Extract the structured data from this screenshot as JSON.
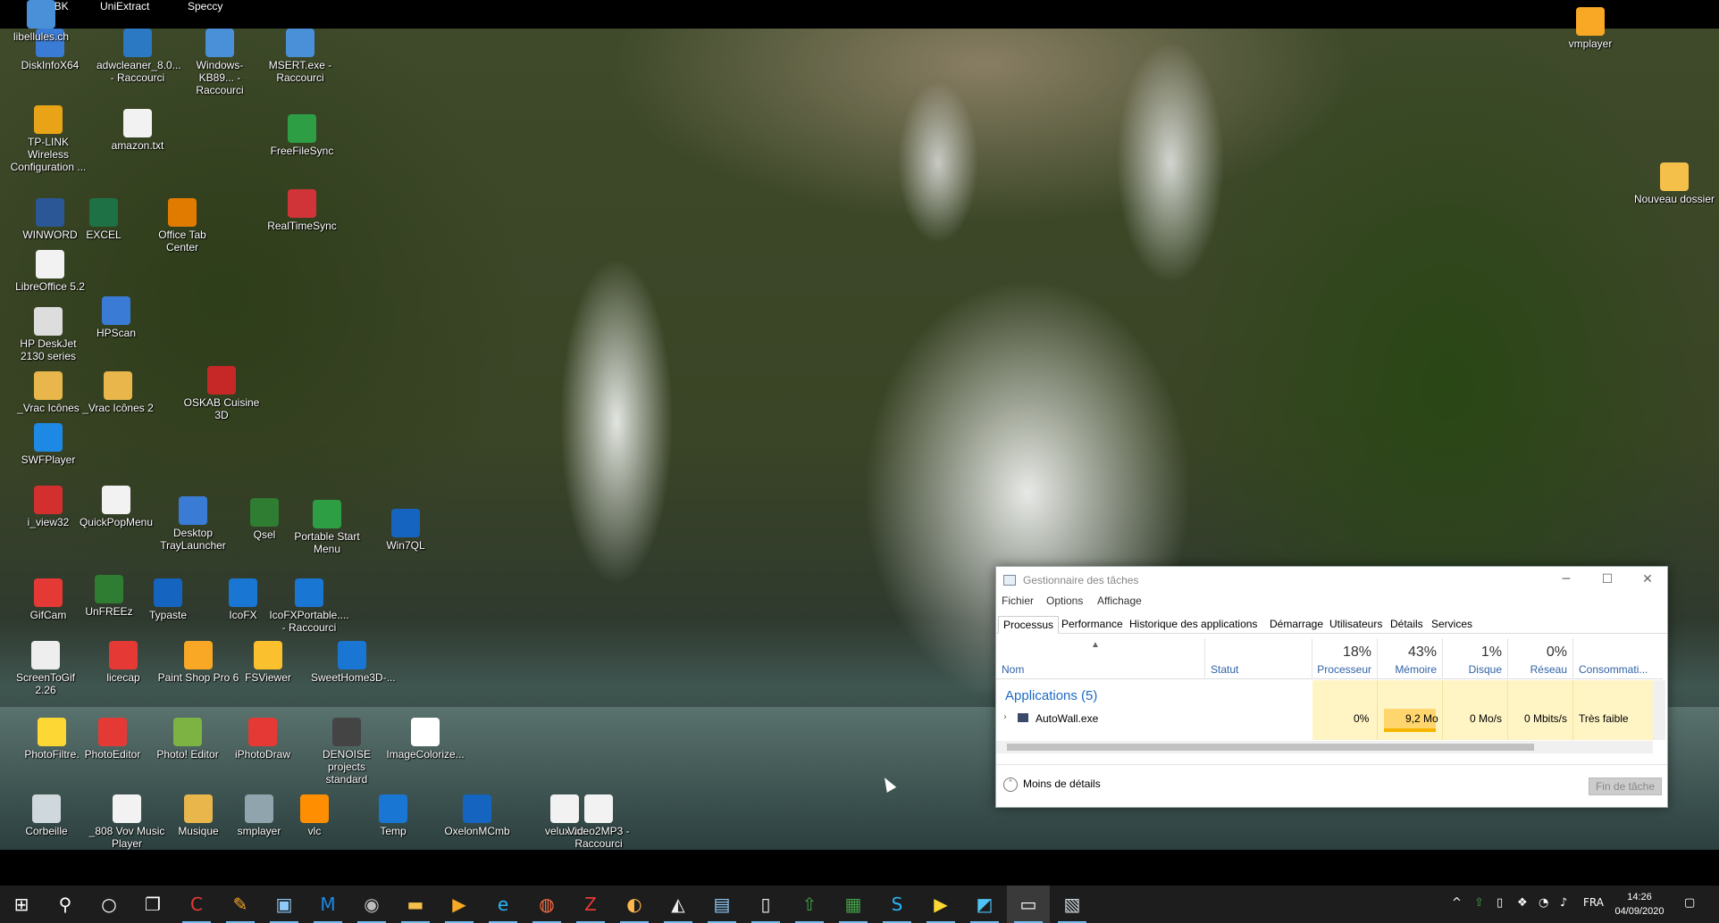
{
  "top_labels": [
    "DrvBK",
    "UniExtract",
    "Speccy"
  ],
  "desktop_icons": [
    {
      "label": "DiskInfoX64",
      "icon": "disk-icon",
      "color": "#3a7bd5"
    },
    {
      "label": "adwcleaner_8.0... - Raccourci",
      "icon": "gear-icon",
      "color": "#2b79c2"
    },
    {
      "label": "Windows-KB89... - Raccourci",
      "icon": "installer-icon",
      "color": "#4a90d9"
    },
    {
      "label": "MSERT.exe - Raccourci",
      "icon": "installer-icon",
      "color": "#4a90d9"
    },
    {
      "label": "TP-LINK Wireless Configuration ...",
      "icon": "wifi-icon",
      "color": "#e8a317"
    },
    {
      "label": "amazon.txt",
      "icon": "text-file-icon",
      "color": "#f2f2f2"
    },
    {
      "label": "FreeFileSync",
      "icon": "sync-icon",
      "color": "#2e9e45"
    },
    {
      "label": "WINWORD",
      "icon": "word-icon",
      "color": "#2b5797"
    },
    {
      "label": "EXCEL",
      "icon": "excel-icon",
      "color": "#1e7145"
    },
    {
      "label": "Office Tab Center",
      "icon": "office-tab-icon",
      "color": "#e07b00"
    },
    {
      "label": "RealTimeSync",
      "icon": "sync-icon",
      "color": "#d13438"
    },
    {
      "label": "LibreOffice 5.2",
      "icon": "document-icon",
      "color": "#f2f2f2"
    },
    {
      "label": "HP DeskJet 2130 series",
      "icon": "printer-icon",
      "color": "#dddddd"
    },
    {
      "label": "HPScan",
      "icon": "scanner-icon",
      "color": "#3a7bd5"
    },
    {
      "label": "_Vrac Icônes",
      "icon": "archive-icon",
      "color": "#e8b64a"
    },
    {
      "label": "_Vrac Icônes 2",
      "icon": "archive-icon",
      "color": "#e8b64a"
    },
    {
      "label": "OSKAB Cuisine 3D",
      "icon": "oskab-icon",
      "color": "#c62828"
    },
    {
      "label": "SWFPlayer",
      "icon": "swf-icon",
      "color": "#1e88e5"
    },
    {
      "label": "i_view32",
      "icon": "irfanview-icon",
      "color": "#d32f2f"
    },
    {
      "label": "QuickPopMenu",
      "icon": "menu-icon",
      "color": "#f2f2f2"
    },
    {
      "label": "Desktop TrayLauncher",
      "icon": "monitor-icon",
      "color": "#3a7bd5"
    },
    {
      "label": "Qsel",
      "icon": "qsel-icon",
      "color": "#2e7d32"
    },
    {
      "label": "Portable Start Menu",
      "icon": "arrow-up-icon",
      "color": "#2e9e45"
    },
    {
      "label": "Win7QL",
      "icon": "launch-icon",
      "color": "#1565c0"
    },
    {
      "label": "GifCam",
      "icon": "camera-icon",
      "color": "#e53935"
    },
    {
      "label": "UnFREEz",
      "icon": "globe-icon",
      "color": "#2e7d32"
    },
    {
      "label": "Typaste",
      "icon": "typaste-icon",
      "color": "#1565c0"
    },
    {
      "label": "IcoFX",
      "icon": "icofx-icon",
      "color": "#1976d2"
    },
    {
      "label": "IcoFXPortable.... - Raccourci",
      "icon": "icofx-icon",
      "color": "#1976d2"
    },
    {
      "label": "ScreenToGif 2.26",
      "icon": "screen-icon",
      "color": "#eeeeee"
    },
    {
      "label": "licecap",
      "icon": "record-icon",
      "color": "#e53935"
    },
    {
      "label": "Paint Shop Pro 6",
      "icon": "palette-icon",
      "color": "#f9a825"
    },
    {
      "label": "FSViewer",
      "icon": "eye-icon",
      "color": "#fbc02d"
    },
    {
      "label": "SweetHome3D-...",
      "icon": "house-icon",
      "color": "#1976d2"
    },
    {
      "label": "PhotoFiltre.",
      "icon": "photofiltre-icon",
      "color": "#fdd835"
    },
    {
      "label": "PhotoEditor",
      "icon": "photo-editor-icon",
      "color": "#e53935"
    },
    {
      "label": "Photo! Editor",
      "icon": "photo-icon",
      "color": "#7cb342"
    },
    {
      "label": "iPhotoDraw",
      "icon": "draw-icon",
      "color": "#e53935"
    },
    {
      "label": "DENOISE projects standard",
      "icon": "lens-icon",
      "color": "#444444"
    },
    {
      "label": "ImageColorize...",
      "icon": "portrait-icon",
      "color": "#ffffff"
    },
    {
      "label": "Corbeille",
      "icon": "recycle-bin-icon",
      "color": "#cfd8dc"
    },
    {
      "label": "_808 Vov Music Player",
      "icon": "music-icon",
      "color": "#f2f2f2"
    },
    {
      "label": "Musique",
      "icon": "folder-music-icon",
      "color": "#e8b64a"
    },
    {
      "label": "smplayer",
      "icon": "film-icon",
      "color": "#90a4ae"
    },
    {
      "label": "vlc",
      "icon": "vlc-cone-icon",
      "color": "#ff8f00"
    },
    {
      "label": "Temp",
      "icon": "folder-icon",
      "color": "#1976d2"
    },
    {
      "label": "OxelonMCmb",
      "icon": "media-converter-icon",
      "color": "#1565c0"
    },
    {
      "label": "velux.txt",
      "icon": "text-file-icon",
      "color": "#f2f2f2"
    },
    {
      "label": "Video2MP3 - Raccourci",
      "icon": "video-icon",
      "color": "#f2f2f2"
    },
    {
      "label": "vmplayer",
      "icon": "play-icon",
      "color": "#f9a825"
    },
    {
      "label": "Nouveau dossier",
      "icon": "folder-icon",
      "color": "#f5c04a"
    },
    {
      "label": "libellules.ch",
      "icon": "web-shortcut-icon",
      "color": "#4a90d9"
    }
  ],
  "taskmgr": {
    "title": "Gestionnaire des tâches",
    "menu": [
      "Fichier",
      "Options",
      "Affichage"
    ],
    "tabs": [
      "Processus",
      "Performance",
      "Historique des applications",
      "Démarrage",
      "Utilisateurs",
      "Détails",
      "Services"
    ],
    "columns": {
      "name": "Nom",
      "status": "Statut",
      "cpu": {
        "pct": "18%",
        "label": "Processeur"
      },
      "memory": {
        "pct": "43%",
        "label": "Mémoire"
      },
      "disk": {
        "pct": "1%",
        "label": "Disque"
      },
      "network": {
        "pct": "0%",
        "label": "Réseau"
      },
      "power": "Consommati..."
    },
    "group_label": "Applications (5)",
    "process": {
      "name": "AutoWall.exe",
      "cpu": "0%",
      "memory": "9,2 Mo",
      "disk": "0 Mo/s",
      "network": "0 Mbits/s",
      "power": "Très faible"
    },
    "less_details": "Moins de détails",
    "end_task": "Fin de tâche"
  },
  "taskbar": {
    "pinned": [
      {
        "name": "start-button",
        "glyph": "⊞",
        "color": "#ffffff"
      },
      {
        "name": "search-icon",
        "glyph": "⚲",
        "color": "#ffffff"
      },
      {
        "name": "cortana-icon",
        "glyph": "○",
        "color": "#ffffff"
      },
      {
        "name": "task-view-icon",
        "glyph": "❐",
        "color": "#ffffff"
      },
      {
        "name": "ccleaner-icon",
        "glyph": "C",
        "color": "#e53935"
      },
      {
        "name": "broom-icon",
        "glyph": "✎",
        "color": "#f9a825"
      },
      {
        "name": "control-panel-icon",
        "glyph": "▣",
        "color": "#90caf9"
      },
      {
        "name": "malwarebytes-icon",
        "glyph": "M",
        "color": "#1e88e5"
      },
      {
        "name": "disc-icon",
        "glyph": "◉",
        "color": "#bdbdbd"
      },
      {
        "name": "file-explorer-icon",
        "glyph": "▬",
        "color": "#f5c04a"
      },
      {
        "name": "media-icon",
        "glyph": "▶",
        "color": "#f9a825"
      },
      {
        "name": "edge-icon",
        "glyph": "e",
        "color": "#29b6f6"
      },
      {
        "name": "firefox-icon",
        "glyph": "◍",
        "color": "#ff7043"
      },
      {
        "name": "filezilla-icon",
        "glyph": "Z",
        "color": "#e53935"
      },
      {
        "name": "drive-icon",
        "glyph": "◐",
        "color": "#ffb74d"
      },
      {
        "name": "inkscape-icon",
        "glyph": "◭",
        "color": "#eeeeee"
      },
      {
        "name": "remote-icon",
        "glyph": "▤",
        "color": "#90caf9"
      },
      {
        "name": "notes-icon",
        "glyph": "▯",
        "color": "#eeeeee"
      },
      {
        "name": "upload-icon",
        "glyph": "⇧",
        "color": "#43a047"
      },
      {
        "name": "spreadsheet-icon",
        "glyph": "▦",
        "color": "#43a047"
      },
      {
        "name": "skype-icon",
        "glyph": "S",
        "color": "#29b6f6"
      },
      {
        "name": "player-icon",
        "glyph": "▶",
        "color": "#fdd835"
      },
      {
        "name": "screenshot-icon",
        "glyph": "◩",
        "color": "#4fc3f7"
      },
      {
        "name": "task-manager-taskbar-icon",
        "glyph": "▭",
        "color": "#ffffff"
      },
      {
        "name": "system-tool-icon",
        "glyph": "▧",
        "color": "#cfd8dc"
      }
    ],
    "tray": {
      "chevron": "^",
      "language": "FRA",
      "time": "14:26",
      "date": "04/09/2020",
      "notification": "▢"
    }
  }
}
